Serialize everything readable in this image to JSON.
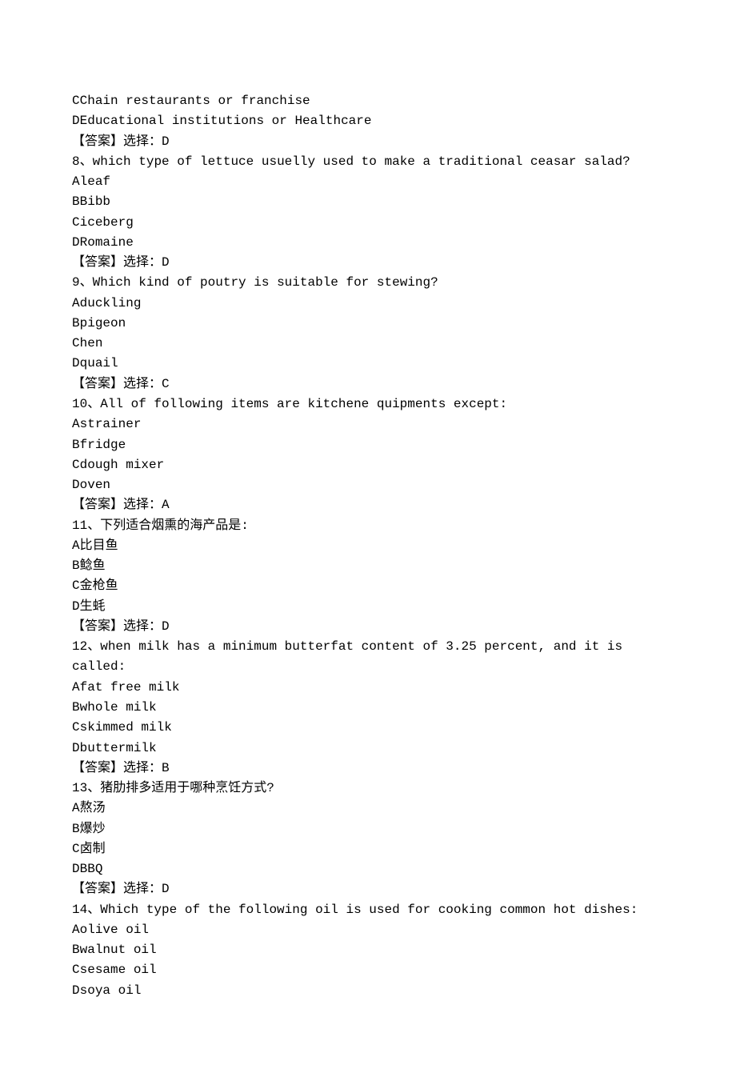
{
  "answer_label": "【答案】选择：",
  "pre_options": [
    {
      "letter": "C",
      "text": "Chain restaurants or franchise"
    },
    {
      "letter": "D",
      "text": "Educational institutions or Healthcare"
    }
  ],
  "pre_answer": "D",
  "questions": [
    {
      "num": "8",
      "sep": "、",
      "stem": "which type of lettuce usuelly used to make a traditional ceasar salad?",
      "options": [
        {
          "letter": "A",
          "text": "leaf"
        },
        {
          "letter": "B",
          "text": "Bibb"
        },
        {
          "letter": "C",
          "text": "iceberg"
        },
        {
          "letter": "D",
          "text": "Romaine"
        }
      ],
      "answer": "D"
    },
    {
      "num": "9",
      "sep": "、",
      "stem": "Which kind of poutry is suitable for stewing?",
      "options": [
        {
          "letter": "A",
          "text": "duckling"
        },
        {
          "letter": "B",
          "text": "pigeon"
        },
        {
          "letter": "C",
          "text": "hen"
        },
        {
          "letter": "D",
          "text": "quail"
        }
      ],
      "answer": "C"
    },
    {
      "num": "10",
      "sep": "、",
      "stem": "All of following items are kitchene quipments except:",
      "options": [
        {
          "letter": "A",
          "text": "strainer"
        },
        {
          "letter": "B",
          "text": "fridge"
        },
        {
          "letter": "C",
          "text": "dough mixer"
        },
        {
          "letter": "D",
          "text": "oven"
        }
      ],
      "answer": "A"
    },
    {
      "num": "11",
      "sep": "、",
      "stem": "下列适合烟熏的海产品是:",
      "options": [
        {
          "letter": "A",
          "text": "比目鱼"
        },
        {
          "letter": "B",
          "text": "鲶鱼"
        },
        {
          "letter": "C",
          "text": "金枪鱼"
        },
        {
          "letter": "D",
          "text": "生蚝"
        }
      ],
      "answer": "D"
    },
    {
      "num": "12",
      "sep": "、",
      "stem": "when milk has a minimum butterfat content of 3.25 percent, and it is called:",
      "options": [
        {
          "letter": "A",
          "text": "fat free milk"
        },
        {
          "letter": "B",
          "text": "whole milk"
        },
        {
          "letter": "C",
          "text": "skimmed milk"
        },
        {
          "letter": "D",
          "text": "buttermilk"
        }
      ],
      "answer": "B"
    },
    {
      "num": "13",
      "sep": "、",
      "stem": "猪肋排多适用于哪种烹饪方式?",
      "options": [
        {
          "letter": "A",
          "text": "熬汤"
        },
        {
          "letter": "B",
          "text": "爆炒"
        },
        {
          "letter": "C",
          "text": "卤制"
        },
        {
          "letter": "D",
          "text": "BBQ"
        }
      ],
      "answer": "D"
    },
    {
      "num": "14",
      "sep": "、",
      "stem": "Which type of the following oil is used for cooking common hot dishes:",
      "options": [
        {
          "letter": "A",
          "text": "olive oil"
        },
        {
          "letter": "B",
          "text": "walnut oil"
        },
        {
          "letter": "C",
          "text": "sesame oil"
        },
        {
          "letter": "D",
          "text": "soya oil"
        }
      ],
      "answer": null
    }
  ]
}
